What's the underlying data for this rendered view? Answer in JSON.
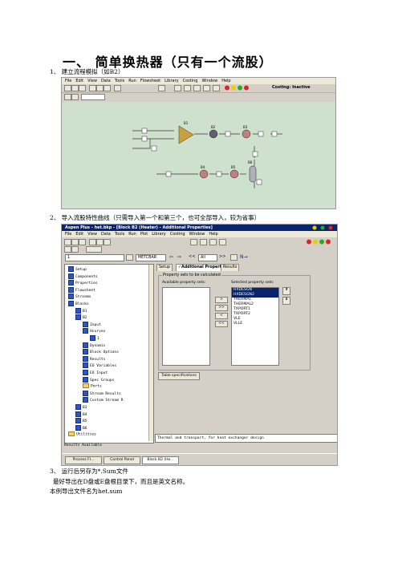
{
  "heading": "一、 简单换热器（只有一个流股）",
  "step1": "1、 建立流程模拟（如B2）",
  "step2": "2、 导入流股特性曲线（只需导入第一个和第三个，也可全部导入，较为省事）",
  "step3": "3、 运行后另存为*.Sum文件",
  "note1": "最好导出在D盘或E盘根目录下，而且是英文名称。",
  "note2": "本例导出文件名为het.sum",
  "shot1": {
    "menu": [
      "File",
      "Edit",
      "View",
      "Data",
      "Tools",
      "Run",
      "Flowsheet",
      "Library",
      "Costing",
      "Window",
      "Help"
    ],
    "costing": "Costing: Inactive",
    "blocks": [
      "B1",
      "B2",
      "B3",
      "B4",
      "B5",
      "B6"
    ]
  },
  "shot2": {
    "title": "Aspen Plus - het.bkp - [Block B2 (Heater) - Additional Properties]",
    "menu": [
      "File",
      "Edit",
      "View",
      "Data",
      "Tools",
      "Run",
      "Plot",
      "Library",
      "Costing",
      "Window",
      "Help"
    ],
    "combo_id": "1",
    "units": "METCBAR",
    "nav_all": "All",
    "tree": [
      {
        "label": "Setup",
        "indent": 0
      },
      {
        "label": "Components",
        "indent": 0
      },
      {
        "label": "Properties",
        "indent": 0
      },
      {
        "label": "Flowsheet",
        "indent": 0
      },
      {
        "label": "Streams",
        "indent": 0
      },
      {
        "label": "Blocks",
        "indent": 0
      },
      {
        "label": "B1",
        "indent": 1
      },
      {
        "label": "B2",
        "indent": 1
      },
      {
        "label": "Input",
        "indent": 2
      },
      {
        "label": "Hcurves",
        "indent": 2
      },
      {
        "label": "1",
        "indent": 3
      },
      {
        "label": "Dynamic",
        "indent": 2
      },
      {
        "label": "Block Options",
        "indent": 2
      },
      {
        "label": "Results",
        "indent": 2
      },
      {
        "label": "EO Variables",
        "indent": 2
      },
      {
        "label": "EO Input",
        "indent": 2
      },
      {
        "label": "Spec Groups",
        "indent": 2
      },
      {
        "label": "Ports",
        "indent": 2
      },
      {
        "label": "Stream Results",
        "indent": 2
      },
      {
        "label": "Custom Stream R",
        "indent": 2
      },
      {
        "label": "B3",
        "indent": 1
      },
      {
        "label": "B4",
        "indent": 1
      },
      {
        "label": "B5",
        "indent": 1
      },
      {
        "label": "B6",
        "indent": 1
      },
      {
        "label": "Utilities",
        "indent": 0
      }
    ],
    "tabs": [
      "Setup",
      "✓Additional Properties",
      "Results"
    ],
    "group_label": "Property sets to be calculated",
    "available_label": "Available property sets:",
    "selected_label": "Selected property sets:",
    "selected_sets": [
      "HXDESGN",
      "HXDESGN2",
      "THERMAL",
      "THERMAL2",
      "TXPORT1",
      "TXPORT2",
      "VLE",
      "VLLE"
    ],
    "table_button": "Table specifications",
    "description": "Thermal and transport, for heat exchanger design",
    "status": "Results Available",
    "taskbar": [
      "Process Fl...",
      "Control Panel",
      "Block B2 (He..."
    ]
  }
}
